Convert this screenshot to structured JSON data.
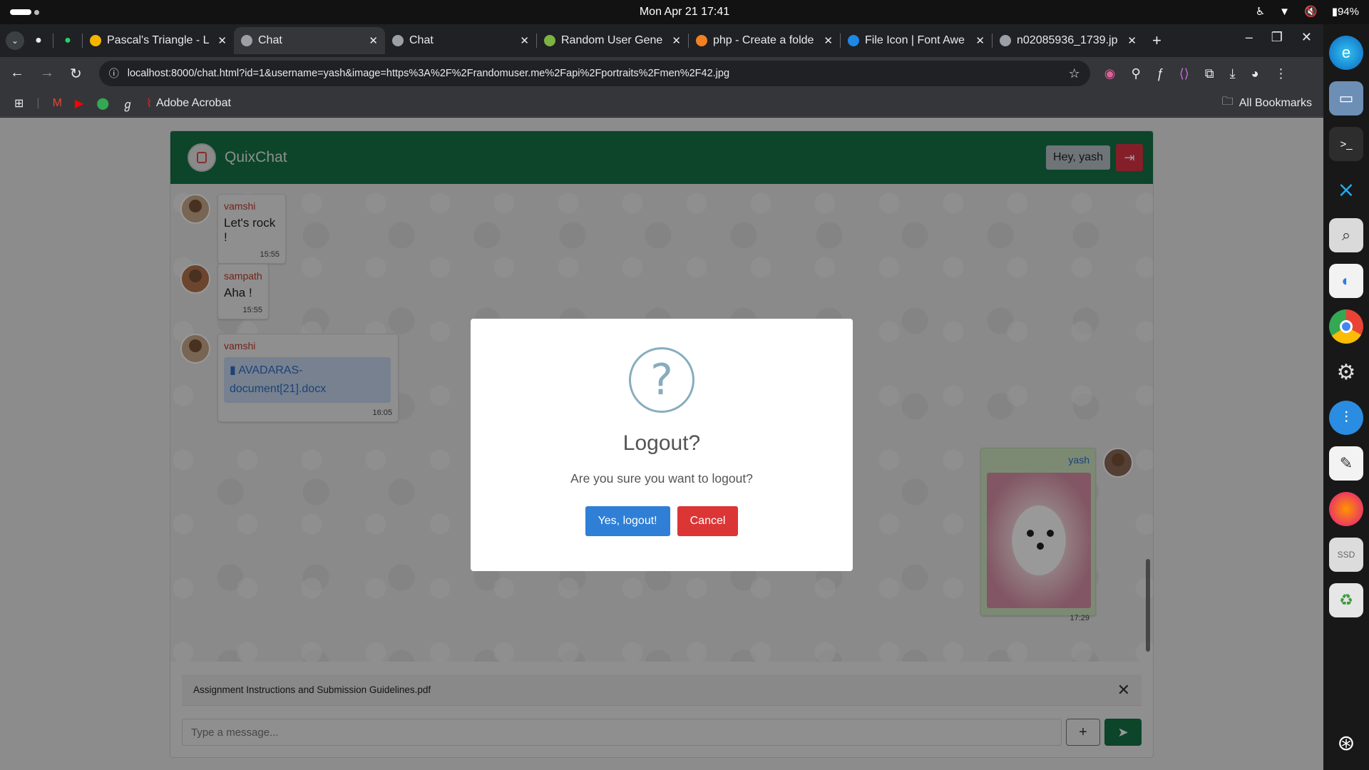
{
  "system": {
    "clock": "Mon Apr 21  17:41",
    "battery": "94%"
  },
  "browser": {
    "tabs": [
      {
        "title": "Pascal's Triangle - L",
        "icon": "code-icon",
        "color": "#f5b400"
      },
      {
        "title": "Chat",
        "icon": "globe-icon",
        "color": "#9aa0a6",
        "active": true
      },
      {
        "title": "Chat",
        "icon": "globe-icon",
        "color": "#9aa0a6"
      },
      {
        "title": "Random User Gene",
        "icon": "user-icon",
        "color": "#7cb342"
      },
      {
        "title": "php - Create a folde",
        "icon": "stackoverflow-icon",
        "color": "#f48024"
      },
      {
        "title": "File Icon | Font Awe",
        "icon": "flag-icon",
        "color": "#1e88e5"
      },
      {
        "title": "n02085936_1739.jp",
        "icon": "globe-icon",
        "color": "#9aa0a6"
      }
    ],
    "url": "localhost:8000/chat.html?id=1&username=yash&image=https%3A%2F%2Frandomuser.me%2Fapi%2Fportraits%2Fmen%2F42.jpg",
    "bookmarks": {
      "acrobat": "Adobe Acrobat",
      "all_bookmarks": "All Bookmarks"
    }
  },
  "app": {
    "brand": "QuixChat",
    "greeting": "Hey, yash",
    "messages": [
      {
        "sender": "vamshi",
        "text": "Let's rock !",
        "time": "15:55"
      },
      {
        "sender": "sampath",
        "text": "Aha !",
        "time": "15:55"
      },
      {
        "sender": "vamshi",
        "file": "AVADARAS-document[21].docx",
        "time": "16:05"
      },
      {
        "sender": "yash",
        "image": "puppy-photo",
        "time": "17:29"
      }
    ],
    "attachment": "Assignment Instructions and Submission Guidelines.pdf",
    "composer_placeholder": "Type a message..."
  },
  "dialog": {
    "title": "Logout?",
    "text": "Are you sure you want to logout?",
    "confirm": "Yes, logout!",
    "cancel": "Cancel"
  },
  "colors": {
    "header_green": "#157347",
    "danger_red": "#dc3545",
    "confirm_blue": "#2f7fd6"
  }
}
